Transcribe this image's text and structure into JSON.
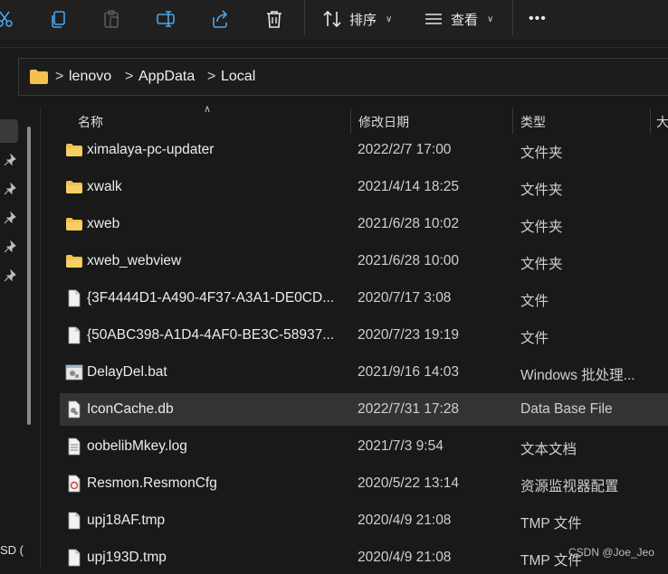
{
  "toolbar": {
    "sort_label": "排序",
    "view_label": "查看",
    "more_label": "•••",
    "icons": [
      "cut-icon",
      "copy-icon",
      "paste-icon",
      "rename-icon",
      "share-icon",
      "delete-icon",
      "sort-icon",
      "view-icon",
      "more-icon"
    ]
  },
  "address": {
    "crumbs": [
      "lenovo",
      "AppData",
      "Local"
    ],
    "separator": ">"
  },
  "columns": {
    "name": "名称",
    "modified": "修改日期",
    "type": "类型",
    "size": "大"
  },
  "files": [
    {
      "name": "ximalaya-pc-updater",
      "date": "2022/2/7 17:00",
      "type": "文件夹",
      "icon": "folder"
    },
    {
      "name": "xwalk",
      "date": "2021/4/14 18:25",
      "type": "文件夹",
      "icon": "folder"
    },
    {
      "name": "xweb",
      "date": "2021/6/28 10:02",
      "type": "文件夹",
      "icon": "folder"
    },
    {
      "name": "xweb_webview",
      "date": "2021/6/28 10:00",
      "type": "文件夹",
      "icon": "folder"
    },
    {
      "name": "{3F4444D1-A490-4F37-A3A1-DE0CD...",
      "date": "2020/7/17 3:08",
      "type": "文件",
      "icon": "file"
    },
    {
      "name": "{50ABC398-A1D4-4AF0-BE3C-58937...",
      "date": "2020/7/23 19:19",
      "type": "文件",
      "icon": "file"
    },
    {
      "name": "DelayDel.bat",
      "date": "2021/9/16 14:03",
      "type": "Windows 批处理...",
      "icon": "bat"
    },
    {
      "name": "IconCache.db",
      "date": "2022/7/31 17:28",
      "type": "Data Base File",
      "icon": "db",
      "selected": true
    },
    {
      "name": "oobelibMkey.log",
      "date": "2021/7/3 9:54",
      "type": "文本文档",
      "icon": "text"
    },
    {
      "name": "Resmon.ResmonCfg",
      "date": "2020/5/22 13:14",
      "type": "资源监视器配置",
      "icon": "cfg"
    },
    {
      "name": "upj18AF.tmp",
      "date": "2020/4/9 21:08",
      "type": "TMP 文件",
      "icon": "file"
    },
    {
      "name": "upj193D.tmp",
      "date": "2020/4/9 21:08",
      "type": "TMP 文件",
      "icon": "file"
    }
  ],
  "nav": {
    "bottom_text": "SD ("
  },
  "watermark": "CSDN @Joe_Jeo",
  "colors": {
    "background": "#191919",
    "toolbar": "#202020",
    "selected_row": "#333333",
    "folder": "#f4c04d",
    "icon_blue": "#4ea4e8"
  }
}
